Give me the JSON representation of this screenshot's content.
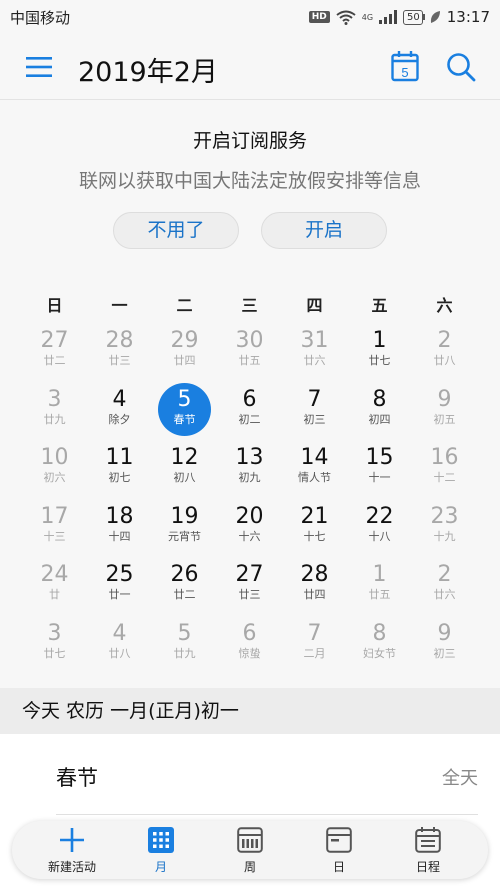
{
  "status_bar": {
    "carrier": "中国移动",
    "hd_label": "HD",
    "network_label": "4G",
    "battery": "50",
    "time": "13:17"
  },
  "app_bar": {
    "title": "2019年2月",
    "today_icon_number": "5",
    "icons": [
      "menu-icon",
      "calendar-today-icon",
      "search-icon"
    ]
  },
  "subscribe": {
    "title": "开启订阅服务",
    "description": "联网以获取中国大陆法定放假安排等信息",
    "decline_label": "不用了",
    "accept_label": "开启"
  },
  "calendar": {
    "weekdays": [
      "日",
      "一",
      "二",
      "三",
      "四",
      "五",
      "六"
    ],
    "weeks": [
      [
        {
          "day": "27",
          "lunar": "廿二",
          "dim": true
        },
        {
          "day": "28",
          "lunar": "廿三",
          "dim": true
        },
        {
          "day": "29",
          "lunar": "廿四",
          "dim": true
        },
        {
          "day": "30",
          "lunar": "廿五",
          "dim": true
        },
        {
          "day": "31",
          "lunar": "廿六",
          "dim": true
        },
        {
          "day": "1",
          "lunar": "廿七",
          "dim": false
        },
        {
          "day": "2",
          "lunar": "廿八",
          "dim": true
        }
      ],
      [
        {
          "day": "3",
          "lunar": "廿九",
          "dim": true
        },
        {
          "day": "4",
          "lunar": "除夕",
          "dim": false
        },
        {
          "day": "5",
          "lunar": "春节",
          "dim": false,
          "today": true
        },
        {
          "day": "6",
          "lunar": "初二",
          "dim": false
        },
        {
          "day": "7",
          "lunar": "初三",
          "dim": false
        },
        {
          "day": "8",
          "lunar": "初四",
          "dim": false
        },
        {
          "day": "9",
          "lunar": "初五",
          "dim": true
        }
      ],
      [
        {
          "day": "10",
          "lunar": "初六",
          "dim": true
        },
        {
          "day": "11",
          "lunar": "初七",
          "dim": false
        },
        {
          "day": "12",
          "lunar": "初八",
          "dim": false
        },
        {
          "day": "13",
          "lunar": "初九",
          "dim": false
        },
        {
          "day": "14",
          "lunar": "情人节",
          "dim": false
        },
        {
          "day": "15",
          "lunar": "十一",
          "dim": false
        },
        {
          "day": "16",
          "lunar": "十二",
          "dim": true
        }
      ],
      [
        {
          "day": "17",
          "lunar": "十三",
          "dim": true
        },
        {
          "day": "18",
          "lunar": "十四",
          "dim": false
        },
        {
          "day": "19",
          "lunar": "元宵节",
          "dim": false
        },
        {
          "day": "20",
          "lunar": "十六",
          "dim": false
        },
        {
          "day": "21",
          "lunar": "十七",
          "dim": false
        },
        {
          "day": "22",
          "lunar": "十八",
          "dim": false
        },
        {
          "day": "23",
          "lunar": "十九",
          "dim": true
        }
      ],
      [
        {
          "day": "24",
          "lunar": "廿",
          "dim": true
        },
        {
          "day": "25",
          "lunar": "廿一",
          "dim": false
        },
        {
          "day": "26",
          "lunar": "廿二",
          "dim": false
        },
        {
          "day": "27",
          "lunar": "廿三",
          "dim": false
        },
        {
          "day": "28",
          "lunar": "廿四",
          "dim": false
        },
        {
          "day": "1",
          "lunar": "廿五",
          "dim": true
        },
        {
          "day": "2",
          "lunar": "廿六",
          "dim": true
        }
      ],
      [
        {
          "day": "3",
          "lunar": "廿七",
          "dim": true
        },
        {
          "day": "4",
          "lunar": "廿八",
          "dim": true
        },
        {
          "day": "5",
          "lunar": "廿九",
          "dim": true
        },
        {
          "day": "6",
          "lunar": "惊蛰",
          "dim": true
        },
        {
          "day": "7",
          "lunar": "二月",
          "dim": true
        },
        {
          "day": "8",
          "lunar": "妇女节",
          "dim": true
        },
        {
          "day": "9",
          "lunar": "初三",
          "dim": true
        }
      ]
    ]
  },
  "lunar_info": "今天  农历 一月(正月)初一",
  "event": {
    "title": "春节",
    "time": "全天"
  },
  "bottom_nav": {
    "items": [
      {
        "label": "新建活动",
        "icon": "plus-icon",
        "active": false
      },
      {
        "label": "月",
        "icon": "month-grid-icon",
        "active": true
      },
      {
        "label": "周",
        "icon": "week-icon",
        "active": false
      },
      {
        "label": "日",
        "icon": "day-icon",
        "active": false
      },
      {
        "label": "日程",
        "icon": "agenda-icon",
        "active": false
      }
    ]
  },
  "colors": {
    "accent": "#1a7fe0",
    "text_dim": "#a8a8a8",
    "background": "#f7f7f7"
  }
}
